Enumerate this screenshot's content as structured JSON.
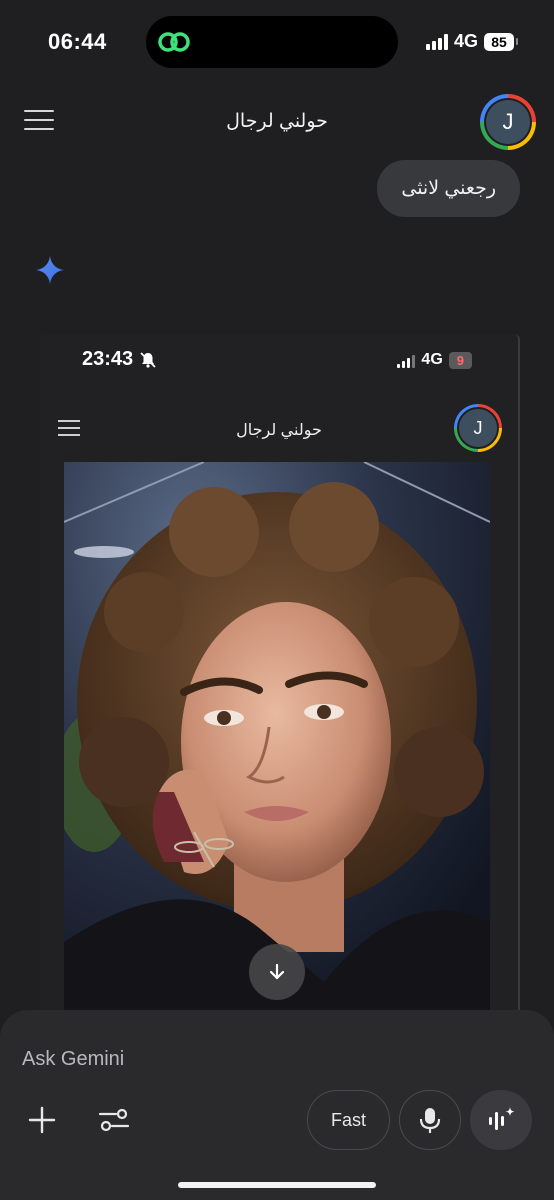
{
  "status_bar": {
    "time": "06:44",
    "network": "4G",
    "battery": "85"
  },
  "header": {
    "title": "حولني لرجال",
    "avatar_letter": "J"
  },
  "chat": {
    "user_message": "رجعني لانثى"
  },
  "embedded_screenshot": {
    "time": "23:43",
    "network": "4G",
    "battery": "9",
    "title": "حولني لرجال",
    "avatar_letter": "J"
  },
  "input": {
    "placeholder": "Ask Gemini",
    "fast_label": "Fast"
  },
  "colors": {
    "background": "#1f1f21",
    "panel": "#2a2a2c",
    "bubble": "#38393c",
    "spark": "#4285f4"
  },
  "icons": [
    "menu-icon",
    "gemini-spark-icon",
    "bell-off-icon",
    "arrow-down-icon",
    "plus-icon",
    "tools-icon",
    "mic-icon",
    "live-icon"
  ]
}
